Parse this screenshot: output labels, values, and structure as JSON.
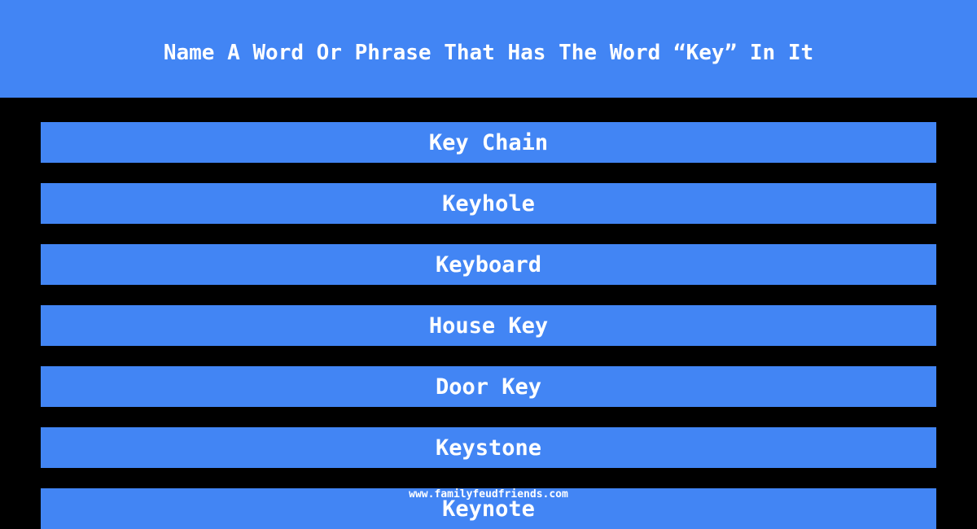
{
  "question": "Name A Word Or Phrase That Has The Word “Key” In It",
  "answers": [
    "Key Chain",
    "Keyhole",
    "Keyboard",
    "House Key",
    "Door Key",
    "Keystone",
    "Keynote"
  ],
  "watermark": "www.familyfeudfriends.com",
  "colors": {
    "accent": "#4285f4",
    "background": "#000000",
    "text": "#ffffff"
  }
}
